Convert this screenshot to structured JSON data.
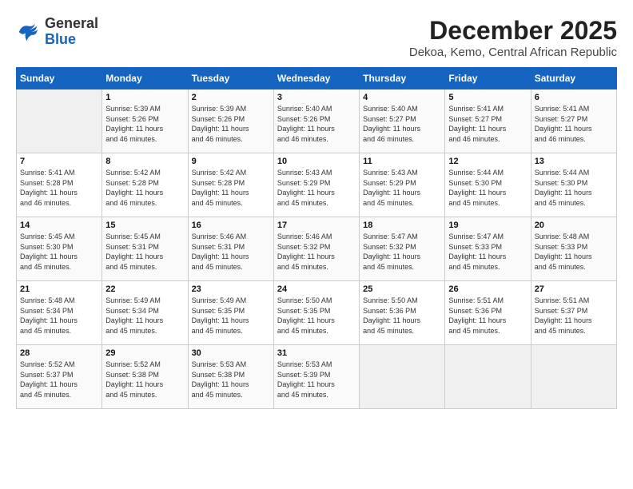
{
  "logo": {
    "general": "General",
    "blue": "Blue"
  },
  "title": "December 2025",
  "subtitle": "Dekoa, Kemo, Central African Republic",
  "days_of_week": [
    "Sunday",
    "Monday",
    "Tuesday",
    "Wednesday",
    "Thursday",
    "Friday",
    "Saturday"
  ],
  "weeks": [
    [
      {
        "day": "",
        "info": ""
      },
      {
        "day": "1",
        "info": "Sunrise: 5:39 AM\nSunset: 5:26 PM\nDaylight: 11 hours\nand 46 minutes."
      },
      {
        "day": "2",
        "info": "Sunrise: 5:39 AM\nSunset: 5:26 PM\nDaylight: 11 hours\nand 46 minutes."
      },
      {
        "day": "3",
        "info": "Sunrise: 5:40 AM\nSunset: 5:26 PM\nDaylight: 11 hours\nand 46 minutes."
      },
      {
        "day": "4",
        "info": "Sunrise: 5:40 AM\nSunset: 5:27 PM\nDaylight: 11 hours\nand 46 minutes."
      },
      {
        "day": "5",
        "info": "Sunrise: 5:41 AM\nSunset: 5:27 PM\nDaylight: 11 hours\nand 46 minutes."
      },
      {
        "day": "6",
        "info": "Sunrise: 5:41 AM\nSunset: 5:27 PM\nDaylight: 11 hours\nand 46 minutes."
      }
    ],
    [
      {
        "day": "7",
        "info": "Sunrise: 5:41 AM\nSunset: 5:28 PM\nDaylight: 11 hours\nand 46 minutes."
      },
      {
        "day": "8",
        "info": "Sunrise: 5:42 AM\nSunset: 5:28 PM\nDaylight: 11 hours\nand 46 minutes."
      },
      {
        "day": "9",
        "info": "Sunrise: 5:42 AM\nSunset: 5:28 PM\nDaylight: 11 hours\nand 45 minutes."
      },
      {
        "day": "10",
        "info": "Sunrise: 5:43 AM\nSunset: 5:29 PM\nDaylight: 11 hours\nand 45 minutes."
      },
      {
        "day": "11",
        "info": "Sunrise: 5:43 AM\nSunset: 5:29 PM\nDaylight: 11 hours\nand 45 minutes."
      },
      {
        "day": "12",
        "info": "Sunrise: 5:44 AM\nSunset: 5:30 PM\nDaylight: 11 hours\nand 45 minutes."
      },
      {
        "day": "13",
        "info": "Sunrise: 5:44 AM\nSunset: 5:30 PM\nDaylight: 11 hours\nand 45 minutes."
      }
    ],
    [
      {
        "day": "14",
        "info": "Sunrise: 5:45 AM\nSunset: 5:30 PM\nDaylight: 11 hours\nand 45 minutes."
      },
      {
        "day": "15",
        "info": "Sunrise: 5:45 AM\nSunset: 5:31 PM\nDaylight: 11 hours\nand 45 minutes."
      },
      {
        "day": "16",
        "info": "Sunrise: 5:46 AM\nSunset: 5:31 PM\nDaylight: 11 hours\nand 45 minutes."
      },
      {
        "day": "17",
        "info": "Sunrise: 5:46 AM\nSunset: 5:32 PM\nDaylight: 11 hours\nand 45 minutes."
      },
      {
        "day": "18",
        "info": "Sunrise: 5:47 AM\nSunset: 5:32 PM\nDaylight: 11 hours\nand 45 minutes."
      },
      {
        "day": "19",
        "info": "Sunrise: 5:47 AM\nSunset: 5:33 PM\nDaylight: 11 hours\nand 45 minutes."
      },
      {
        "day": "20",
        "info": "Sunrise: 5:48 AM\nSunset: 5:33 PM\nDaylight: 11 hours\nand 45 minutes."
      }
    ],
    [
      {
        "day": "21",
        "info": "Sunrise: 5:48 AM\nSunset: 5:34 PM\nDaylight: 11 hours\nand 45 minutes."
      },
      {
        "day": "22",
        "info": "Sunrise: 5:49 AM\nSunset: 5:34 PM\nDaylight: 11 hours\nand 45 minutes."
      },
      {
        "day": "23",
        "info": "Sunrise: 5:49 AM\nSunset: 5:35 PM\nDaylight: 11 hours\nand 45 minutes."
      },
      {
        "day": "24",
        "info": "Sunrise: 5:50 AM\nSunset: 5:35 PM\nDaylight: 11 hours\nand 45 minutes."
      },
      {
        "day": "25",
        "info": "Sunrise: 5:50 AM\nSunset: 5:36 PM\nDaylight: 11 hours\nand 45 minutes."
      },
      {
        "day": "26",
        "info": "Sunrise: 5:51 AM\nSunset: 5:36 PM\nDaylight: 11 hours\nand 45 minutes."
      },
      {
        "day": "27",
        "info": "Sunrise: 5:51 AM\nSunset: 5:37 PM\nDaylight: 11 hours\nand 45 minutes."
      }
    ],
    [
      {
        "day": "28",
        "info": "Sunrise: 5:52 AM\nSunset: 5:37 PM\nDaylight: 11 hours\nand 45 minutes."
      },
      {
        "day": "29",
        "info": "Sunrise: 5:52 AM\nSunset: 5:38 PM\nDaylight: 11 hours\nand 45 minutes."
      },
      {
        "day": "30",
        "info": "Sunrise: 5:53 AM\nSunset: 5:38 PM\nDaylight: 11 hours\nand 45 minutes."
      },
      {
        "day": "31",
        "info": "Sunrise: 5:53 AM\nSunset: 5:39 PM\nDaylight: 11 hours\nand 45 minutes."
      },
      {
        "day": "",
        "info": ""
      },
      {
        "day": "",
        "info": ""
      },
      {
        "day": "",
        "info": ""
      }
    ]
  ]
}
